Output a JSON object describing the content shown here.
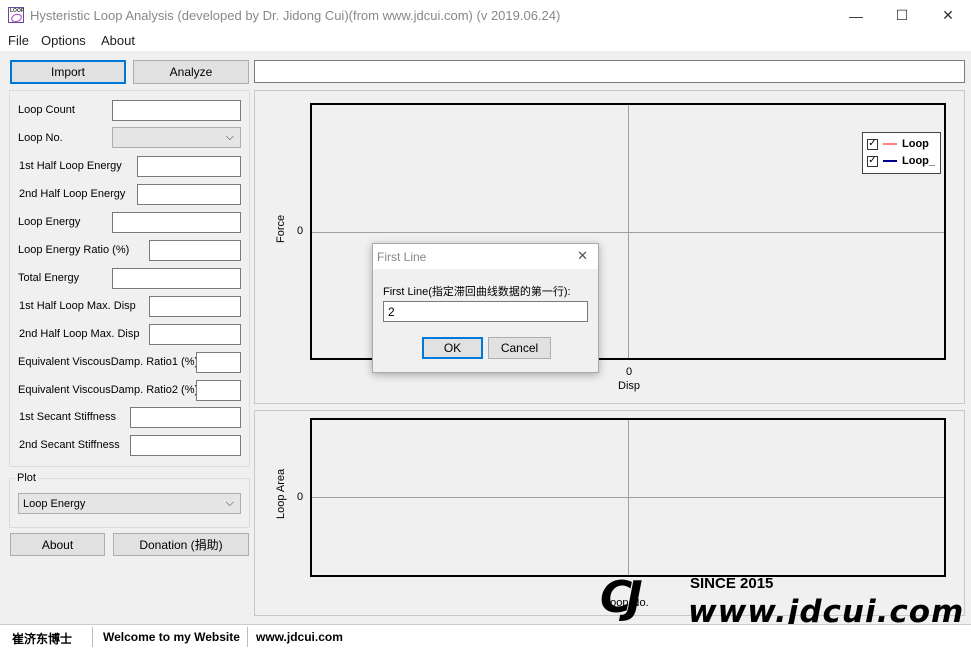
{
  "window": {
    "title": "Hysteristic Loop Analysis (developed by Dr. Jidong Cui)(from www.jdcui.com) (v 2019.06.24)",
    "icon_text": "LOOP",
    "controls": {
      "minimize": "—",
      "maximize": "☐",
      "close": "✕"
    }
  },
  "menu": [
    "File",
    "Options",
    "About"
  ],
  "toolbar": {
    "import_label": "Import",
    "analyze_label": "Analyze",
    "path_value": ""
  },
  "results": [
    {
      "label": "Loop Count",
      "value": ""
    },
    {
      "label": "Loop No.",
      "value": ""
    },
    {
      "label": "1st Half Loop Energy",
      "value": ""
    },
    {
      "label": "2nd Half Loop Energy",
      "value": ""
    },
    {
      "label": "Loop Energy",
      "value": ""
    },
    {
      "label": "Loop Energy Ratio (%)",
      "value": ""
    },
    {
      "label": "Total Energy",
      "value": ""
    },
    {
      "label": "1st Half Loop Max. Disp",
      "value": ""
    },
    {
      "label": "2nd Half Loop Max. Disp",
      "value": ""
    },
    {
      "label": "Equivalent ViscousDamp. Ratio1 (%)",
      "value": ""
    },
    {
      "label": "Equivalent ViscousDamp. Ratio2 (%)",
      "value": ""
    },
    {
      "label": "1st Secant Stiffness",
      "value": ""
    },
    {
      "label": "2nd Secant Stiffness",
      "value": ""
    }
  ],
  "plot_group": {
    "label": "Plot",
    "selected": "Loop Energy"
  },
  "bottom_buttons": {
    "about_label": "About",
    "donation_label": "Donation (捐助)"
  },
  "chart_top": {
    "ylabel": "Force",
    "xlabel": "Disp",
    "y_tick": "0",
    "x_tick": "0",
    "legend": [
      {
        "name": "Loop",
        "checked": true,
        "color": "#ff8080"
      },
      {
        "name": "Loop_",
        "checked": true,
        "color": "#00008b"
      }
    ]
  },
  "chart_bottom": {
    "ylabel": "Loop Area",
    "xlabel": "Loop No.",
    "y_tick": "0"
  },
  "dialog": {
    "title": "First Line",
    "prompt": "First Line(指定滞回曲线数据的第一行):",
    "value": "2",
    "ok_label": "OK",
    "cancel_label": "Cancel",
    "close": "✕"
  },
  "statusbar": [
    "崔济东博士",
    "Welcome to my Website",
    "www.jdcui.com"
  ],
  "watermark": {
    "since": "SINCE 2015",
    "url": "www.jdcui.com",
    "logo": "CJ"
  }
}
